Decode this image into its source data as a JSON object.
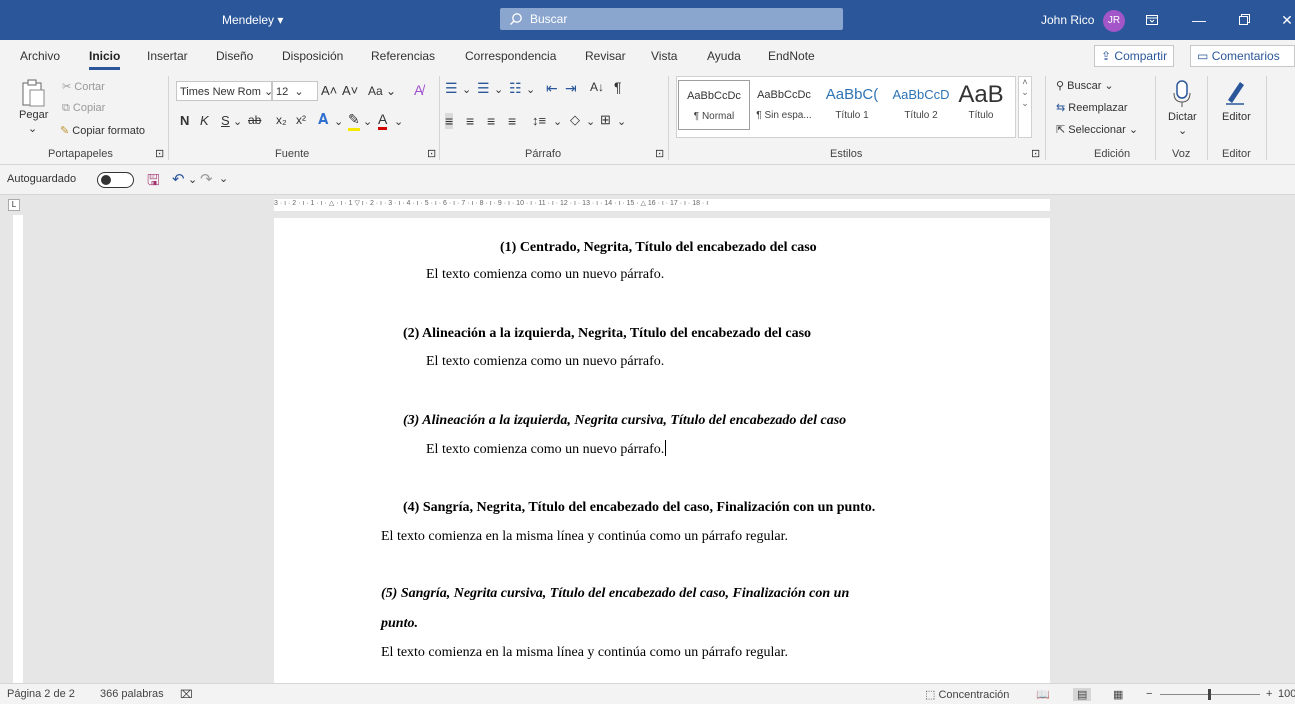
{
  "titlebar": {
    "app_title": "Mendeley",
    "search_placeholder": "Buscar",
    "user_name": "John Rico",
    "user_initials": "JR",
    "colors": {
      "titlebar_bg": "#2b579a",
      "avatar_bg": "#a256c8"
    }
  },
  "tabs": {
    "items": [
      "Archivo",
      "Inicio",
      "Insertar",
      "Diseño",
      "Disposición",
      "Referencias",
      "Correspondencia",
      "Revisar",
      "Vista",
      "Ayuda",
      "EndNote"
    ],
    "active": "Inicio",
    "share_label": "Compartir",
    "comments_label": "Comentarios"
  },
  "ribbon": {
    "clipboard": {
      "paste": "Pegar",
      "cut": "Cortar",
      "copy": "Copiar",
      "format_painter": "Copiar formato",
      "group_label": "Portapapeles"
    },
    "font": {
      "font_name": "Times New Rom",
      "font_size": "12",
      "case_label": "Aa",
      "bold": "N",
      "italic": "K",
      "underline": "S",
      "strike": "ab",
      "group_label": "Fuente"
    },
    "paragraph": {
      "group_label": "Párrafo"
    },
    "styles": {
      "items": [
        {
          "preview": "AaBbCcDc",
          "name": "¶ Normal"
        },
        {
          "preview": "AaBbCcDc",
          "name": "¶ Sin espa..."
        },
        {
          "preview": "AaBbC(",
          "name": "Título 1"
        },
        {
          "preview": "AaBbCcD",
          "name": "Título 2"
        },
        {
          "preview": "AaB",
          "name": "Título"
        }
      ],
      "group_label": "Estilos"
    },
    "editing": {
      "find": "Buscar",
      "replace": "Reemplazar",
      "select": "Seleccionar",
      "group_label": "Edición"
    },
    "voice": {
      "dictate": "Dictar",
      "group_label": "Voz"
    },
    "editor": {
      "label": "Editor",
      "group_label": "Editor"
    }
  },
  "qat": {
    "autosave_label": "Autoguardado"
  },
  "ruler": {
    "labels": "3 · ı · 2 · ı · 1 · ı · △ · ı · 1 ▽ ı · 2 · ı · 3 · ı · 4 · ı · 5 · ı · 6 · ı · 7 · ı · 8 · ı · 9 · ı · 10 · ı · 11 · ı · 12 · ı · 13 · ı · 14 · ı · 15 · △ 16 · ı · 17 · ı · 18 · ı"
  },
  "document": {
    "lines": [
      "(1) Centrado, Negrita, Título del encabezado del caso",
      "El texto comienza como un nuevo párrafo.",
      "(2) Alineación a la izquierda, Negrita, Título del encabezado del caso",
      "El texto comienza como un nuevo párrafo.",
      "(3) Alineación a la izquierda, Negrita cursiva, Título del encabezado del caso",
      "El texto comienza como un nuevo párrafo.",
      "(4)  Sangría, Negrita, Título del encabezado del caso, Finalización con un punto.",
      "El texto comienza en la misma línea y continúa como un párrafo regular.",
      "(5)  Sangría, Negrita cursiva, Título del encabezado del caso, Finalización con un",
      "punto.",
      "El texto comienza en la misma línea y continúa como un párrafo regular."
    ]
  },
  "statusbar": {
    "page": "Página 2 de 2",
    "words": "366 palabras",
    "focus": "Concentración",
    "zoom": "100"
  }
}
